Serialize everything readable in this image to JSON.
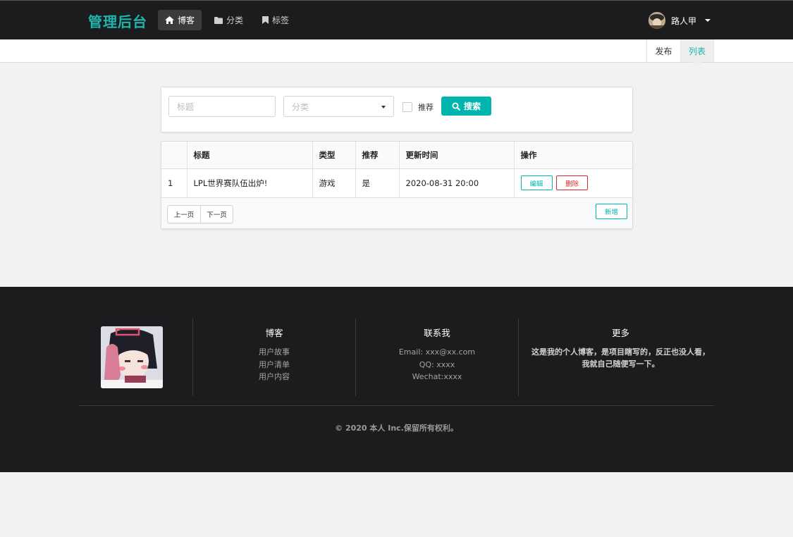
{
  "brand": {
    "title": "管理后台",
    "color": "#1fb5ac"
  },
  "nav": {
    "items": [
      {
        "label": "博客",
        "icon": "home-icon",
        "active": true
      },
      {
        "label": "分类",
        "icon": "folder-icon",
        "active": false
      },
      {
        "label": "标签",
        "icon": "bookmark-icon",
        "active": false
      }
    ],
    "user": {
      "name": "路人甲",
      "icon": "caret-down-icon"
    }
  },
  "submenu": {
    "items": [
      {
        "label": "发布",
        "active": false
      },
      {
        "label": "列表",
        "active": true
      }
    ]
  },
  "search": {
    "title_placeholder": "标题",
    "category_placeholder": "分类",
    "recommend_label": "推荐",
    "recommend_checked": false,
    "button_label": "搜索",
    "button_icon": "search-icon",
    "accent": "#00b5ad"
  },
  "table": {
    "headers": [
      "",
      "标题",
      "类型",
      "推荐",
      "更新时间",
      "操作"
    ],
    "rows": [
      {
        "index": "1",
        "title": "LPL世界赛队伍出炉!",
        "type": "游戏",
        "recommend": "是",
        "updated": "2020-08-31 20:00",
        "edit_label": "编辑",
        "delete_label": "删除"
      }
    ],
    "prev_label": "上一页",
    "next_label": "下一页",
    "new_label": "新增"
  },
  "footer": {
    "col_blog": {
      "title": "博客",
      "links": [
        "用户故事",
        "用户清单",
        "用户内容"
      ]
    },
    "col_contact": {
      "title": "联系我",
      "lines": [
        "Email: xxx@xx.com",
        "QQ: xxxx",
        "Wechat:xxxx"
      ]
    },
    "col_more": {
      "title": "更多",
      "text": "这是我的个人博客，是项目瞎写的，反正也没人看，我就自己随便写一下。"
    },
    "copyright": "© 2020 本人 Inc.保留所有权利。"
  }
}
